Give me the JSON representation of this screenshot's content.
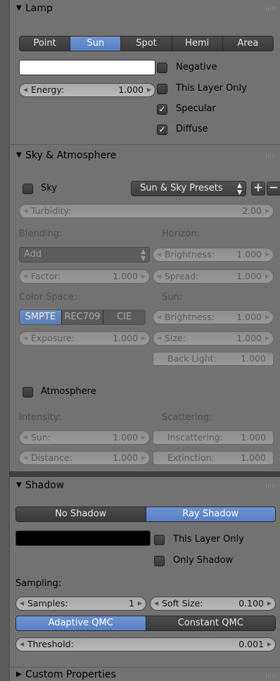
{
  "lamp": {
    "title": "Lamp",
    "types": [
      "Point",
      "Sun",
      "Spot",
      "Hemi",
      "Area"
    ],
    "selected_type": "Sun",
    "energy_label": "Energy:",
    "energy_value": "1.000",
    "negative_label": "Negative",
    "this_layer_only_label": "This Layer Only",
    "specular_label": "Specular",
    "diffuse_label": "Diffuse",
    "swatch_color": "#ffffff"
  },
  "sky": {
    "title": "Sky & Atmosphere",
    "sky_label": "Sky",
    "presets_label": "Sun & Sky Presets",
    "turbidity_label": "Turbidity:",
    "turbidity_value": "2.00",
    "blending_label": "Blending:",
    "blend_mode": "Add",
    "factor_label": "Factor:",
    "factor_value": "1.000",
    "horizon_label": "Horizon:",
    "horizon_brightness_label": "Brightness:",
    "horizon_brightness_value": "1.000",
    "spread_label": "Spread:",
    "spread_value": "1.000",
    "color_space_label": "Color Space:",
    "color_spaces": [
      "SMPTE",
      "REC709",
      "CIE"
    ],
    "exposure_label": "Exposure:",
    "exposure_value": "1.000",
    "sun_label": "Sun:",
    "sun_brightness_label": "Brightness:",
    "sun_brightness_value": "1.000",
    "size_label": "Size:",
    "size_value": "1.000",
    "back_light_label": "Back Light:",
    "back_light_value": "1.000",
    "atmosphere_label": "Atmosphere",
    "intensity_label": "Intensity:",
    "int_sun_label": "Sun:",
    "int_sun_value": "1.000",
    "distance_label": "Distance:",
    "distance_value": "1.000",
    "scattering_label": "Scattering:",
    "inscattering_label": "Inscattering:",
    "inscattering_value": "1.000",
    "extinction_label": "Extinction:",
    "extinction_value": "1.000"
  },
  "shadow": {
    "title": "Shadow",
    "no_shadow_label": "No Shadow",
    "ray_shadow_label": "Ray Shadow",
    "this_layer_only_label": "This Layer Only",
    "only_shadow_label": "Only Shadow",
    "sampling_label": "Sampling:",
    "samples_label": "Samples:",
    "samples_value": "1",
    "soft_size_label": "Soft Size:",
    "soft_size_value": "0.100",
    "adaptive_label": "Adaptive QMC",
    "constant_label": "Constant QMC",
    "threshold_label": "Threshold:",
    "threshold_value": "0.001",
    "swatch_color": "#000000"
  },
  "custom": {
    "title": "Custom Properties"
  },
  "colors": {
    "selected": "#5680c2",
    "panel": "#727272"
  }
}
